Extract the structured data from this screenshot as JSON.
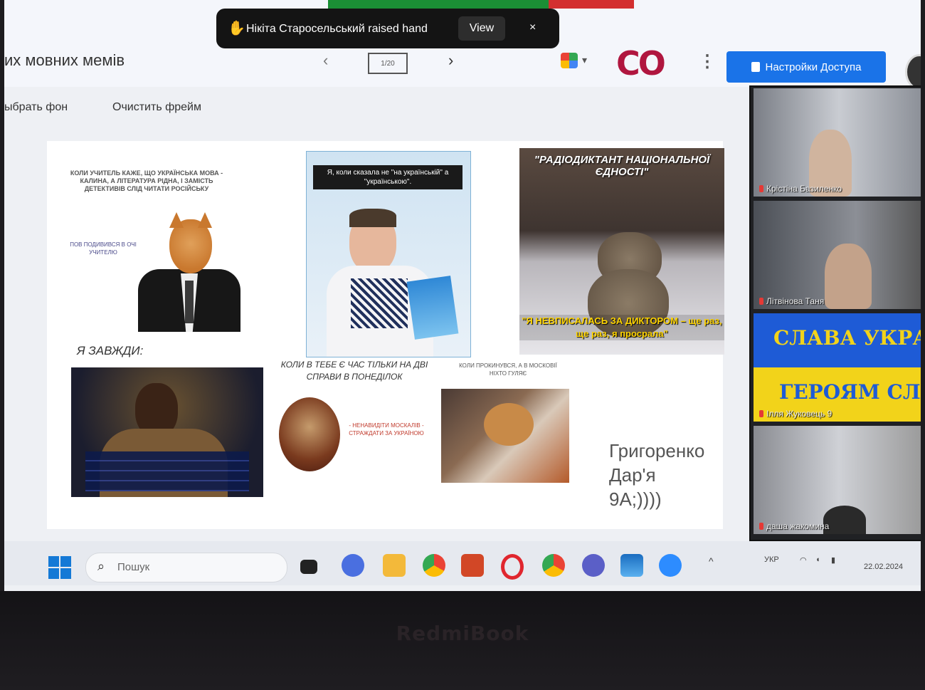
{
  "header": {
    "doc_title": "их мовних мемів",
    "page_indicator": "1/20",
    "prev_icon": "‹",
    "next_icon": "›",
    "co_logo": "CO",
    "access_button": "Настройки Доступа",
    "toolbar_pick_bg": "ыбрать фон",
    "toolbar_clear": "Очистить фрейм"
  },
  "notification": {
    "text": "Нікіта Старосельський raised hand",
    "view_button": "View",
    "close": "×"
  },
  "slide": {
    "meme1_caption_top": "КОЛИ УЧИТЕЛЬ КАЖЕ, ЩО УКРАЇНСЬКА МОВА - КАЛИНА, А ЛІТЕРАТУРА РІДНА, І ЗАМІСТЬ ДЕТЕКТИВІВ СЛІД ЧИТАТИ РОСІЙСЬКУ",
    "meme1_caption_side": "ПОВ ПОДИВИВСЯ В ОЧІ УЧИТЕЛЮ",
    "meme2_title": "Я, коли сказала не \"на українській\" а \"українською\".",
    "meme3_title": "\"РАДІОДИКТАНТ НАЦІОНАЛЬНОЇ ЄДНОСТІ\"",
    "meme3_bottom": "\"Я НЕВПИСАЛАСЬ ЗА ДИКТОРОМ – ще раз, ще раз, я просрала\"",
    "meme4_caption": "Я ЗАВЖДИ:",
    "meme5_caption": "КОЛИ В ТЕБЕ Є ЧАС ТІЛЬКИ НА ДВІ СПРАВИ В ПОНЕДІЛОК",
    "meme5_side": "- НЕНАВИДІТИ МОСКАЛІВ - СТРАЖДАТИ ЗА УКРАЇНОЮ",
    "meme6_caption": "КОЛИ ПРОКИНУВСЯ, А В МОСКОВІЇ НІХТО ГУЛЯЄ",
    "author": [
      "Григоренко",
      "Дар'я",
      "9А;))))"
    ]
  },
  "participants": [
    {
      "name": "Крістіна Базиленко"
    },
    {
      "name": "Літвінова Таня"
    },
    {
      "name": "Ілля Жуковець 9",
      "banner_top": "СЛАВА УКРАЇНІ",
      "banner_bottom": "ГЕРОЯМ СЛАВА"
    },
    {
      "name": "даша жакомина"
    }
  ],
  "taskbar": {
    "search_placeholder": "Пошук",
    "lang": "УКР",
    "date": "22.02.2024"
  },
  "device_brand": "RedmiBook"
}
